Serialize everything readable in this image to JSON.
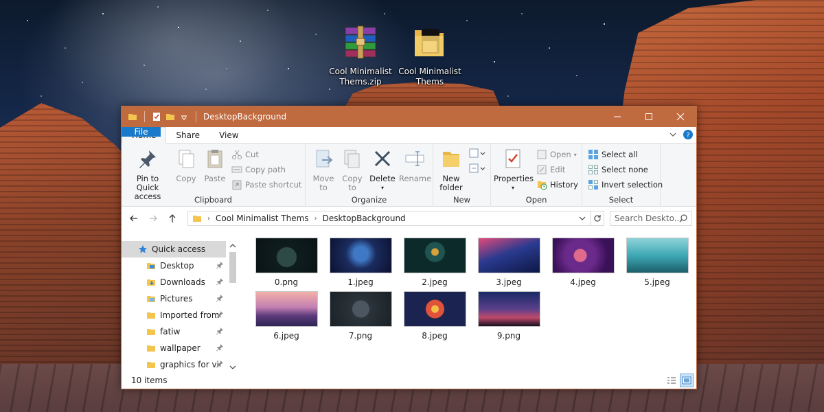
{
  "desktop": {
    "icons": [
      {
        "label_line1": "Cool Minimalist",
        "label_line2": "Thems.zip",
        "icon": "winrar-archive-icon"
      },
      {
        "label_line1": "Cool Minimalist",
        "label_line2": "Thems",
        "icon": "folder-icon"
      }
    ]
  },
  "window": {
    "title": "DesktopBackground",
    "accent": "#c06a3f",
    "tabs": [
      "File",
      "Home",
      "Share",
      "View"
    ],
    "ribbon": {
      "clipboard": {
        "label": "Clipboard",
        "pin_line1": "Pin to Quick",
        "pin_line2": "access",
        "copy": "Copy",
        "paste": "Paste",
        "cut": "Cut",
        "copy_path": "Copy path",
        "paste_shortcut": "Paste shortcut"
      },
      "organize": {
        "label": "Organize",
        "move_line1": "Move",
        "move_line2": "to",
        "copy_line1": "Copy",
        "copy_line2": "to",
        "delete": "Delete",
        "rename": "Rename"
      },
      "new": {
        "label": "New",
        "folder_line1": "New",
        "folder_line2": "folder"
      },
      "open": {
        "label": "Open",
        "properties": "Properties",
        "open": "Open",
        "edit": "Edit",
        "history": "History"
      },
      "select": {
        "label": "Select",
        "select_all": "Select all",
        "select_none": "Select none",
        "invert": "Invert selection"
      }
    },
    "address": {
      "crumbs": [
        "Cool Minimalist Thems",
        "DesktopBackground"
      ],
      "search_placeholder": "Search Deskto..."
    },
    "nav": {
      "quick_access": "Quick access",
      "items": [
        "Desktop",
        "Downloads",
        "Pictures",
        "Imported from P",
        "fatiw",
        "wallpaper",
        "graphics for vide"
      ]
    },
    "files": [
      "0.png",
      "1.jpeg",
      "2.jpeg",
      "3.jpeg",
      "4.jpeg",
      "5.jpeg",
      "6.jpeg",
      "7.png",
      "8.jpeg",
      "9.png"
    ],
    "status": "10 items"
  }
}
